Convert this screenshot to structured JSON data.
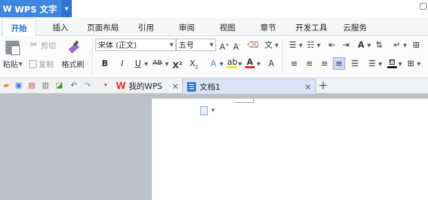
{
  "app": {
    "title": "WPS 文字",
    "logo": "W"
  },
  "tabs": [
    "开始",
    "插入",
    "页面布局",
    "引用",
    "审阅",
    "视图",
    "章节",
    "开发工具",
    "云服务"
  ],
  "ribbon": {
    "cut": "剪切",
    "copy": "复制",
    "paste": "粘贴",
    "format_painter": "格式刷",
    "font_name": "宋体 (正文)",
    "font_size": "五号"
  },
  "doc_tabs": {
    "home": "我的WPS",
    "doc": "文档1"
  },
  "colors": {
    "accent": "#3f86e0",
    "tab_active": "#1f6fd6",
    "doc_tab_bg": "#d9e5f6"
  },
  "icons": [
    "paste-icon",
    "cut-icon",
    "copy-icon",
    "format-painter-icon",
    "bold-icon",
    "italic-icon",
    "underline-icon",
    "strikethrough-icon",
    "superscript-icon",
    "subscript-icon",
    "font-color-icon",
    "highlight-icon",
    "bullets-icon",
    "numbering-icon",
    "align-left-icon",
    "align-center-icon",
    "align-right-icon",
    "justify-icon",
    "save-icon",
    "undo-icon",
    "redo-icon",
    "new-tab-icon"
  ]
}
